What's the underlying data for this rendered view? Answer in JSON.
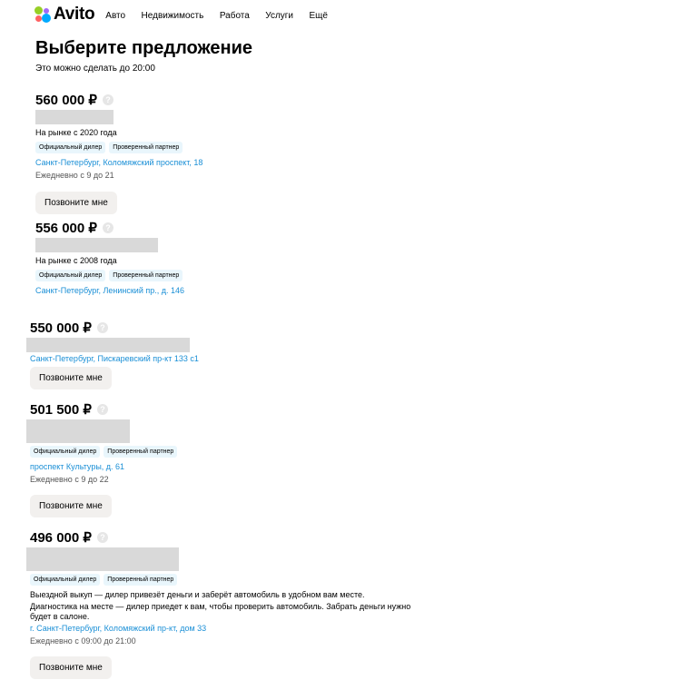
{
  "header": {
    "logo_text": "Avito",
    "nav": [
      "Авто",
      "Недвижимость",
      "Работа",
      "Услуги",
      "Ещё"
    ]
  },
  "page": {
    "title": "Выберите предложение",
    "subtitle": "Это можно сделать до 20:00"
  },
  "common": {
    "help_glyph": "?",
    "call_button": "Позвоните мне",
    "badge_official": "Официальный дилер",
    "badge_partner": "Проверенный партнер"
  },
  "offers": [
    {
      "price": "560 000 ₽",
      "since": "На рынке с 2020 года",
      "address": "Санкт-Петербург, Коломяжский проспект, 18",
      "hours": "Ежедневно с 9 до 21"
    },
    {
      "price": "556 000 ₽",
      "since": "На рынке с 2008 года",
      "address": "Санкт-Петербург, Ленинский пр., д. 146"
    },
    {
      "price": "550 000 ₽",
      "address": "Санкт-Петербург, Пискаревский пр-кт 133 с1"
    },
    {
      "price": "501 500 ₽",
      "address": "проспект Культуры, д. 61",
      "hours": "Ежедневно с 9 до 22"
    },
    {
      "price": "496 000 ₽",
      "note1": "Выездной выкуп — дилер привезёт деньги и заберёт автомобиль в удобном вам месте.",
      "note2": "Диагностика на месте — дилер приедет к вам, чтобы проверить автомобиль. Забрать деньги нужно будет в салоне.",
      "address": "г. Санкт-Петербург, Коломяжский пр-кт, дом 33",
      "hours": "Ежедневно с 09:00 до 21:00"
    }
  ]
}
